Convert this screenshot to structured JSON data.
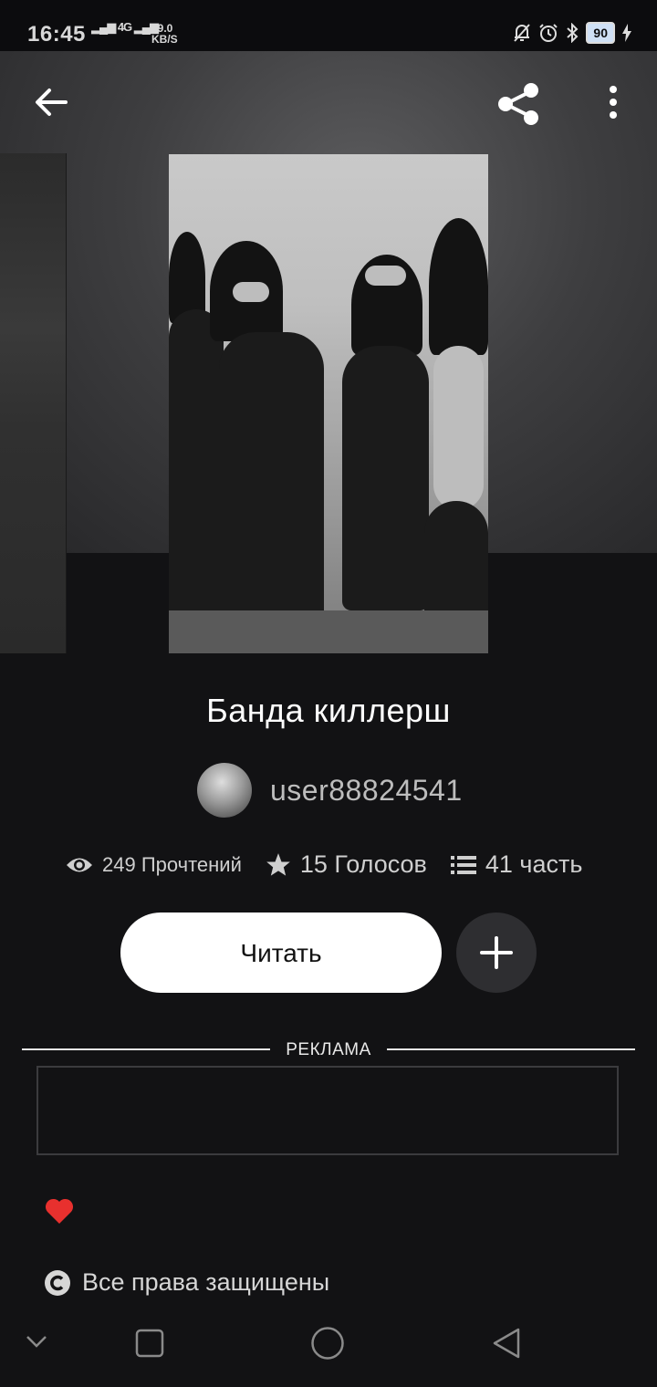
{
  "status_bar": {
    "time": "16:45",
    "signal": "4G",
    "speed_value": "99.0",
    "speed_unit": "KB/S",
    "battery": "90"
  },
  "story": {
    "title": "Банда киллерш",
    "author": "user88824541"
  },
  "stats": {
    "reads": "249 Прочтений",
    "votes": "15 Голосов",
    "parts": "41 часть"
  },
  "actions": {
    "read_label": "Читать"
  },
  "ad": {
    "label": "РЕКЛАМА"
  },
  "footer": {
    "copyright": "Все права защищены"
  },
  "icons": {
    "back": "arrow-left-icon",
    "share": "share-icon",
    "more": "more-vertical-icon",
    "reads": "eye-icon",
    "votes": "star-icon",
    "parts": "list-icon",
    "add": "plus-icon",
    "tag": "heart-icon",
    "copyright": "copyright-icon"
  }
}
